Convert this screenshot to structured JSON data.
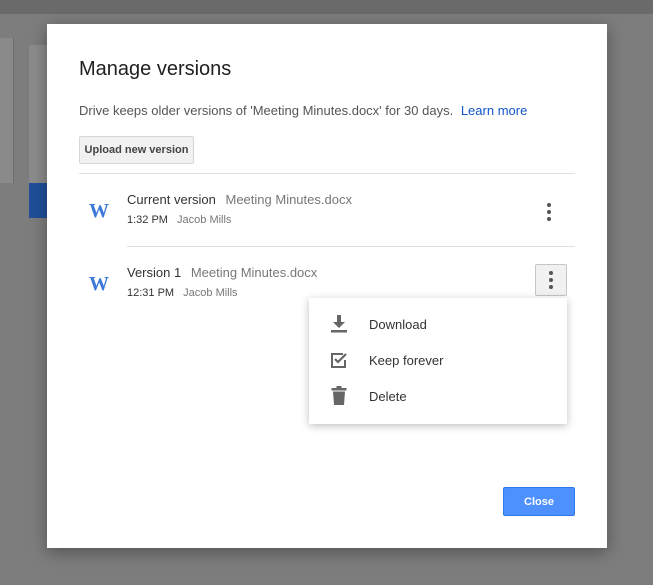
{
  "dialog": {
    "title": "Manage versions",
    "description": "Drive keeps older versions of 'Meeting Minutes.docx' for 30 days.",
    "learn_more": "Learn more",
    "upload_label": "Upload new version",
    "close_label": "Close"
  },
  "versions": [
    {
      "name": "Current version",
      "file": "Meeting Minutes.docx",
      "time": "1:32 PM",
      "user": "Jacob Mills",
      "icon": "word-doc-icon",
      "icon_glyph": "W"
    },
    {
      "name": "Version 1",
      "file": "Meeting Minutes.docx",
      "time": "12:31 PM",
      "user": "Jacob Mills",
      "icon": "word-doc-icon",
      "icon_glyph": "W"
    }
  ],
  "menu": {
    "items": [
      {
        "label": "Download",
        "icon": "download-icon"
      },
      {
        "label": "Keep forever",
        "icon": "checkbox-checked-icon"
      },
      {
        "label": "Delete",
        "icon": "trash-icon"
      }
    ]
  },
  "colors": {
    "accent": "#4d90fe",
    "link": "#1155cc",
    "word_icon": "#3c78d8",
    "overlay": "#7d7d7d"
  }
}
